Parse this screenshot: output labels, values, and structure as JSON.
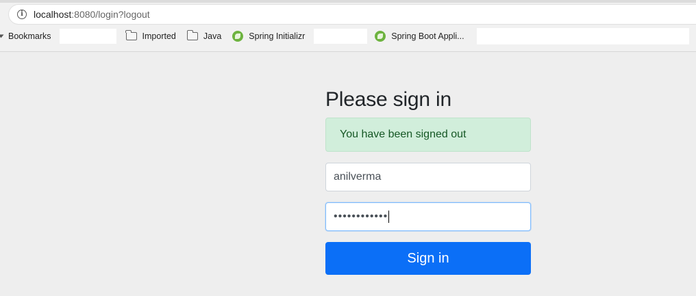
{
  "browser": {
    "url_host": "localhost",
    "url_rest": ":8080/login?logout",
    "bookmarks_label": "Bookmarks",
    "bookmarks": [
      {
        "label": "Imported",
        "icon": "folder-icon"
      },
      {
        "label": "Java",
        "icon": "folder-icon"
      },
      {
        "label": "Spring Initializr",
        "icon": "spring-icon"
      },
      {
        "label": "Spring Boot Appli...",
        "icon": "spring-icon"
      }
    ]
  },
  "login": {
    "heading": "Please sign in",
    "alert": "You have been signed out",
    "username_value": "anilverma",
    "password_mask": "••••••••••••",
    "submit_label": "Sign in"
  },
  "colors": {
    "background": "#eeeeee",
    "alert_bg": "#d1eedb",
    "alert_text": "#155724",
    "button_bg": "#0b6ff7",
    "spring_green": "#6db33f"
  }
}
